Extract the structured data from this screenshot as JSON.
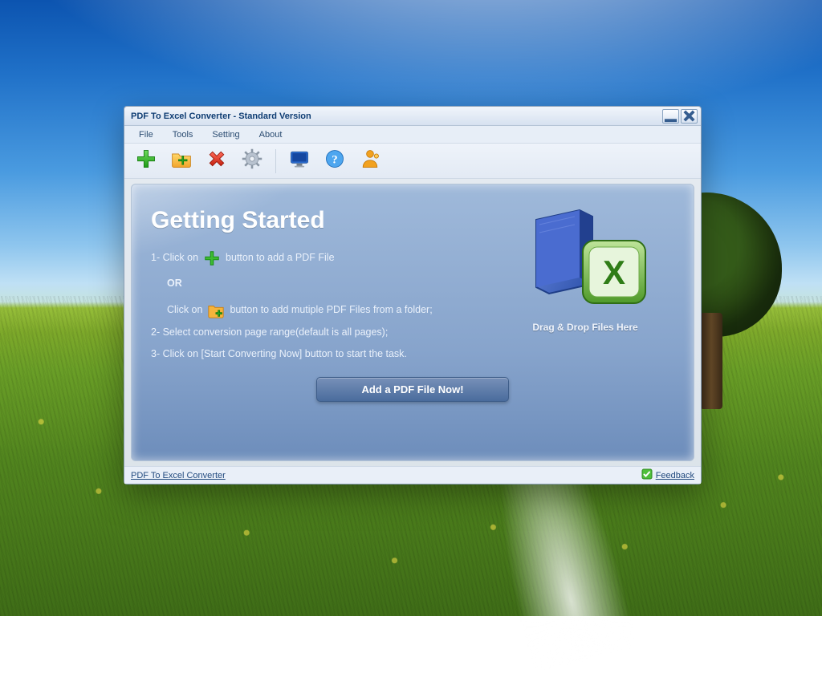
{
  "window": {
    "title": "PDF To Excel Converter - Standard Version"
  },
  "menu": {
    "items": [
      "File",
      "Tools",
      "Setting",
      "About"
    ]
  },
  "content": {
    "heading": "Getting Started",
    "step1_a": "1- Click on",
    "step1_b": "button to add a PDF File",
    "or": "OR",
    "step1c_a": "Click on",
    "step1c_b": "button to add mutiple PDF Files from a folder;",
    "step2": "2- Select conversion page range(default is all pages);",
    "step3": "3- Click on [Start Converting Now] button to start the task.",
    "cta": "Add a PDF File Now!",
    "drop_label": "Drag & Drop Files Here"
  },
  "status": {
    "left": "PDF To Excel Converter",
    "right": "Feedback"
  }
}
